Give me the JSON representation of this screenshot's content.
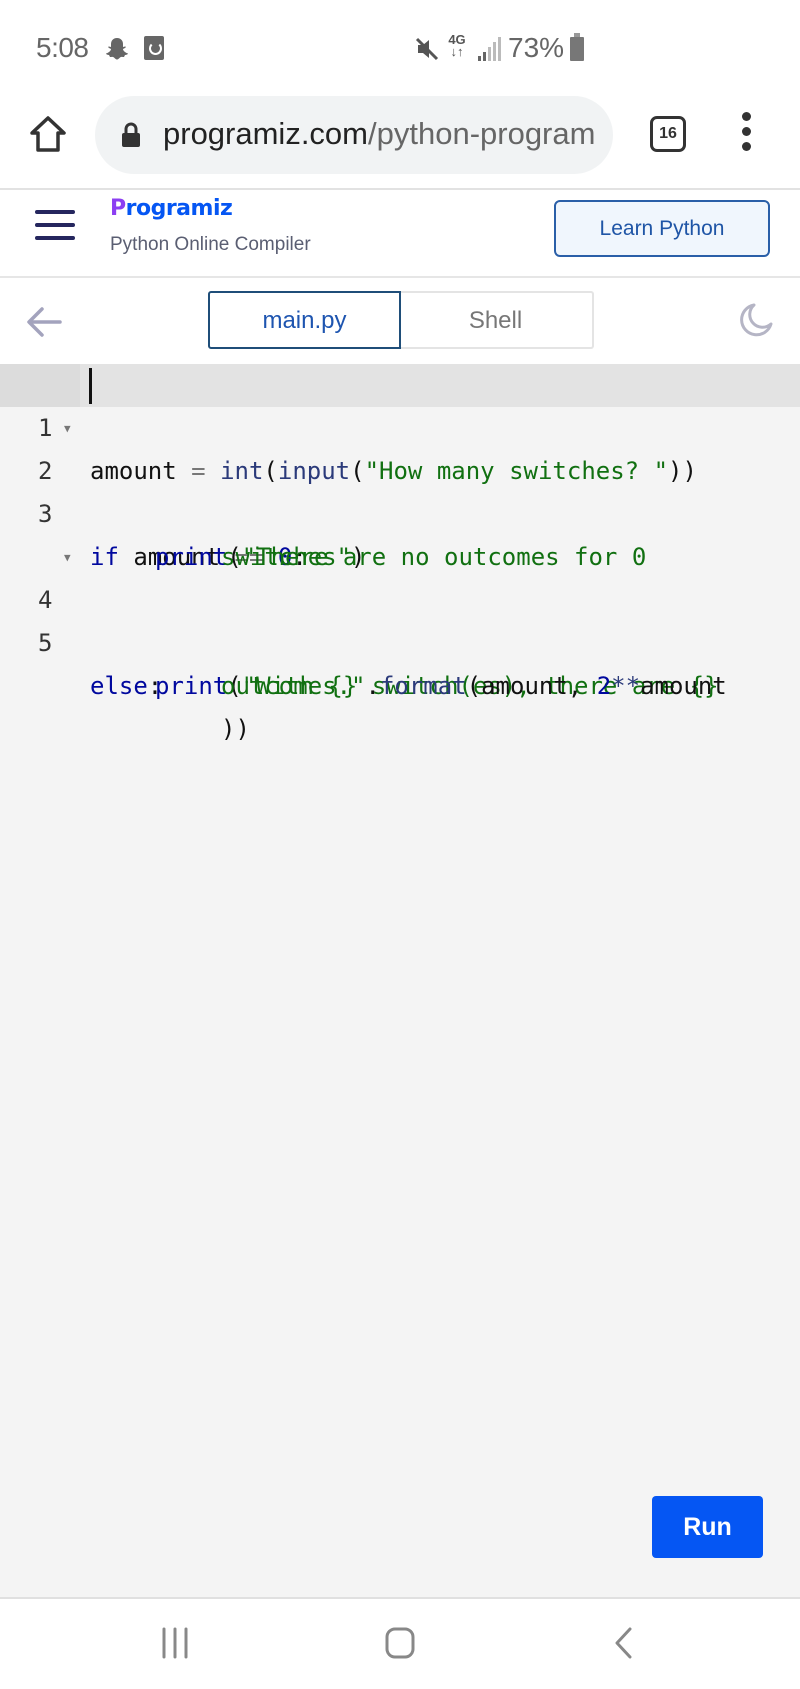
{
  "status_bar": {
    "time": "5:08",
    "left_icons": [
      "snapchat-icon",
      "app-notification-icon"
    ],
    "right_icons": [
      "mute-icon",
      "4g-lte-icon",
      "signal-icon",
      "battery-icon"
    ],
    "network": "4G",
    "battery_percent": "73%"
  },
  "browser": {
    "url_domain": "programiz.com",
    "url_path": "/python-program",
    "tab_count": "16",
    "icons": [
      "home-icon",
      "lock-icon",
      "tabs-icon",
      "menu-icon"
    ]
  },
  "header": {
    "logo_initial": "P",
    "logo_rest": "rogramiz",
    "subtitle": "Python Online Compiler",
    "learn_button": "Learn Python"
  },
  "toolbar": {
    "tabs": [
      {
        "label": "main.py",
        "active": true
      },
      {
        "label": "Shell",
        "active": false
      }
    ]
  },
  "editor": {
    "active_line": 1,
    "lines": [
      {
        "number": "1",
        "foldable": false
      },
      {
        "number": "2",
        "foldable": true
      },
      {
        "number": "3",
        "foldable": false
      },
      {
        "number": "4",
        "foldable": true
      },
      {
        "number": "5",
        "foldable": false
      }
    ],
    "tokens": {
      "l1_var": "amount",
      "l1_eq": " = ",
      "l1_int": "int",
      "l1_p1": "(",
      "l1_input": "input",
      "l1_p2": "(",
      "l1_str": "\"How many switches? \"",
      "l1_close": "))",
      "l2_if": "if",
      "l2_var": " amount ",
      "l2_op": "==",
      "l2_sp": " ",
      "l2_num": "0",
      "l2_colon": ":",
      "l3_print": "print",
      "l3_paren": "(",
      "l3_str_a": "\"There are no outcomes for 0",
      "l3_str_b": "switches\"",
      "l3_close": ")",
      "l4_else": "else",
      "l4_colon": ":",
      "l5_print": "print",
      "l5_paren": "(",
      "l5_str_a": "\"With {} switch(es), there are {}",
      "l5_str_b": "outcomes.\"",
      "l5_dot": ".",
      "l5_format": "format",
      "l5_args1": "(amount, ",
      "l5_num": "2",
      "l5_op": "**",
      "l5_args2": "amount",
      "l5_close": "))"
    },
    "run_button": "Run"
  },
  "nav_bar": {
    "buttons": [
      "recent-apps",
      "home",
      "back"
    ]
  }
}
